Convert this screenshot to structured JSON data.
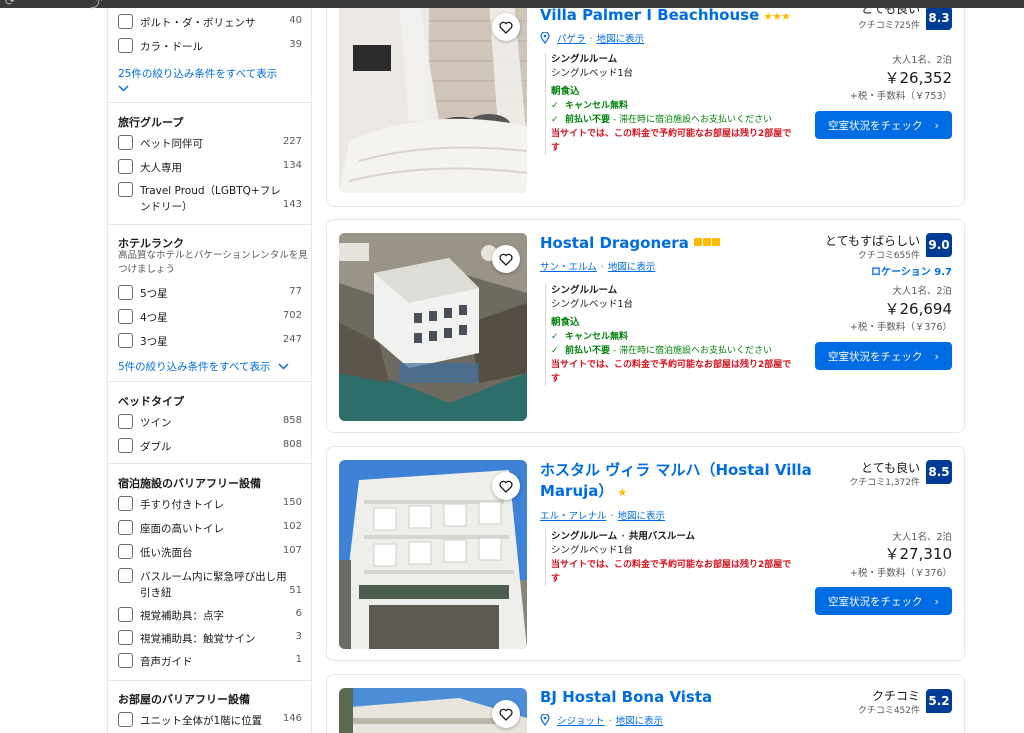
{
  "browser": {
    "left_glyph": "⟳",
    "right_glyph": "⤴"
  },
  "sidebar": {
    "top_options": [
      {
        "label": "ポルト・ダ・ボリェンサ",
        "count": "40"
      },
      {
        "label": "カラ・ドール",
        "count": "39"
      }
    ],
    "top_show_all": "25件の絞り込み条件をすべて表示",
    "travel_group": {
      "title": "旅行グループ",
      "options": [
        {
          "label": "ペット同伴可",
          "count": "227"
        },
        {
          "label": "大人専用",
          "count": "134"
        },
        {
          "label": "Travel Proud（LGBTQ+フレンドリー）",
          "count": "143"
        }
      ]
    },
    "hotel_rank": {
      "title": "ホテルランク",
      "subtitle": "高品質なホテルとバケーションレンタルを見つけましょう",
      "options": [
        {
          "label": "5つ星",
          "count": "77"
        },
        {
          "label": "4つ星",
          "count": "702"
        },
        {
          "label": "3つ星",
          "count": "247"
        }
      ],
      "show_all": "5件の絞り込み条件をすべて表示"
    },
    "bed_type": {
      "title": "ベッドタイプ",
      "options": [
        {
          "label": "ツイン",
          "count": "858"
        },
        {
          "label": "ダブル",
          "count": "808"
        }
      ]
    },
    "facility_accessibility": {
      "title": "宿泊施設のバリアフリー設備",
      "options": [
        {
          "label": "手すり付きトイレ",
          "count": "150"
        },
        {
          "label": "座面の高いトイレ",
          "count": "102"
        },
        {
          "label": "低い洗面台",
          "count": "107"
        },
        {
          "label": "バスルーム内に緊急呼び出し用引き紐",
          "count": "51"
        },
        {
          "label": "視覚補助具：点字",
          "count": "6"
        },
        {
          "label": "視覚補助具：触覚サイン",
          "count": "3"
        },
        {
          "label": "音声ガイド",
          "count": "1"
        }
      ]
    },
    "room_accessibility": {
      "title": "お部屋のバリアフリー設備",
      "options": [
        {
          "label": "ユニット全体が1階に位置",
          "count": "146"
        }
      ]
    }
  },
  "cards": [
    {
      "name": "Villa Palmer I Beachhouse",
      "stars": "★★★",
      "area": "パゲラ",
      "map_link": "地図に表示",
      "room_type": "シングルルーム",
      "bed": "シングルベッド1台",
      "meal": "朝食込",
      "cancel": "キャンセル無料",
      "prepay_bold": "前払い不要",
      "prepay_rest": " - 滞在時に宿泊施設へお支払いください",
      "scarcity": "当サイトでは、この料金で予約可能なお部屋は残り2部屋です",
      "rating_word": "とても良い",
      "reviews": "クチコミ725件",
      "score": "8.3",
      "guests": "大人1名、2泊",
      "price": "￥26,352",
      "tax": "+税・手数料（￥753）",
      "cta": "空室状況をチェック"
    },
    {
      "name": "Hostal Dragonera",
      "area": "サン・エルム",
      "map_link": "地図に表示",
      "room_type": "シングルルーム",
      "bed": "シングルベッド1台",
      "meal": "朝食込",
      "cancel": "キャンセル無料",
      "prepay_bold": "前払い不要",
      "prepay_rest": " - 滞在時に宿泊施設へお支払いください",
      "scarcity": "当サイトでは、この料金で予約可能なお部屋は残り2部屋です",
      "rating_word": "とてもすばらしい",
      "reviews": "クチコミ655件",
      "score": "9.0",
      "location_score": "ロケーション 9.7",
      "guests": "大人1名、2泊",
      "price": "￥26,694",
      "tax": "+税・手数料（￥376）",
      "cta": "空室状況をチェック"
    },
    {
      "name_line1": "ホスタル ヴィラ マルハ（Hostal Villa",
      "name_line2": "Maruja）",
      "stars": "★",
      "area": "エル・アレナル",
      "map_link": "地図に表示",
      "room_type": "シングルルーム",
      "room_extra": "共用バスルーム",
      "bed": "シングルベッド1台",
      "scarcity": "当サイトでは、この料金で予約可能なお部屋は残り2部屋です",
      "rating_word": "とても良い",
      "reviews": "クチコミ1,372件",
      "score": "8.5",
      "guests": "大人1名、2泊",
      "price": "￥27,310",
      "tax": "+税・手数料（￥376）",
      "cta": "空室状況をチェック"
    },
    {
      "name": "BJ Hostal Bona Vista",
      "area": "シジョット",
      "map_link": "地図に表示",
      "rating_word": "クチコミ",
      "reviews": "クチコミ452件",
      "score": "5.2"
    }
  ]
}
